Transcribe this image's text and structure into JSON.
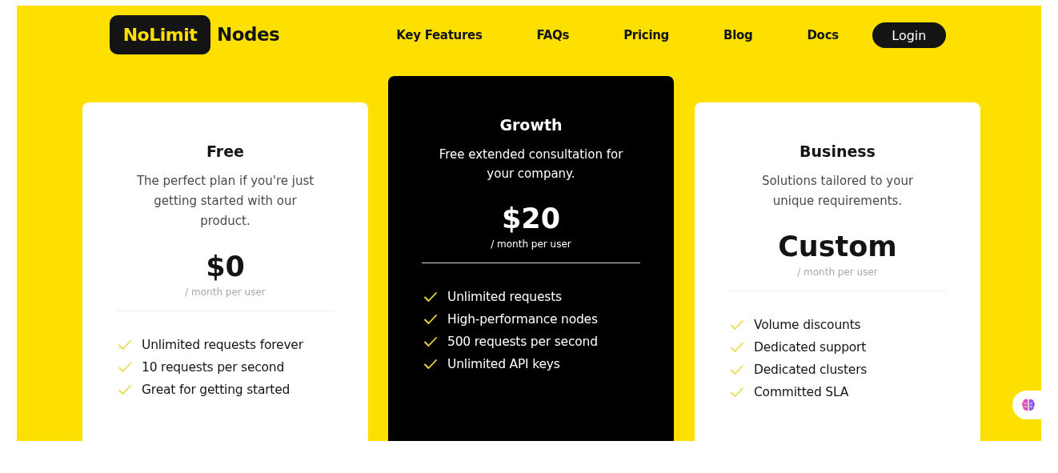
{
  "header": {
    "logo": {
      "badge": "NoLimit",
      "text": "Nodes"
    },
    "nav": [
      "Key Features",
      "FAQs",
      "Pricing",
      "Blog",
      "Docs"
    ],
    "login": "Login"
  },
  "plans": [
    {
      "name": "Free",
      "highlighted": false,
      "description": "The perfect plan if you're just getting started with our product.",
      "price": "$0",
      "period": "/ month per user",
      "features": [
        "Unlimited requests forever",
        "10 requests per second",
        "Great for getting started"
      ]
    },
    {
      "name": "Growth",
      "highlighted": true,
      "description": "Free extended consultation for your company.",
      "price": "$20",
      "period": "/ month per user",
      "features": [
        "Unlimited requests",
        "High-performance nodes",
        "500 requests per second",
        "Unlimited API keys"
      ]
    },
    {
      "name": "Business",
      "highlighted": false,
      "description": "Solutions tailored to your unique requirements.",
      "price": "Custom",
      "period": "/ month per user",
      "features": [
        "Volume discounts",
        "Dedicated support",
        "Dedicated clusters",
        "Committed SLA"
      ]
    }
  ]
}
